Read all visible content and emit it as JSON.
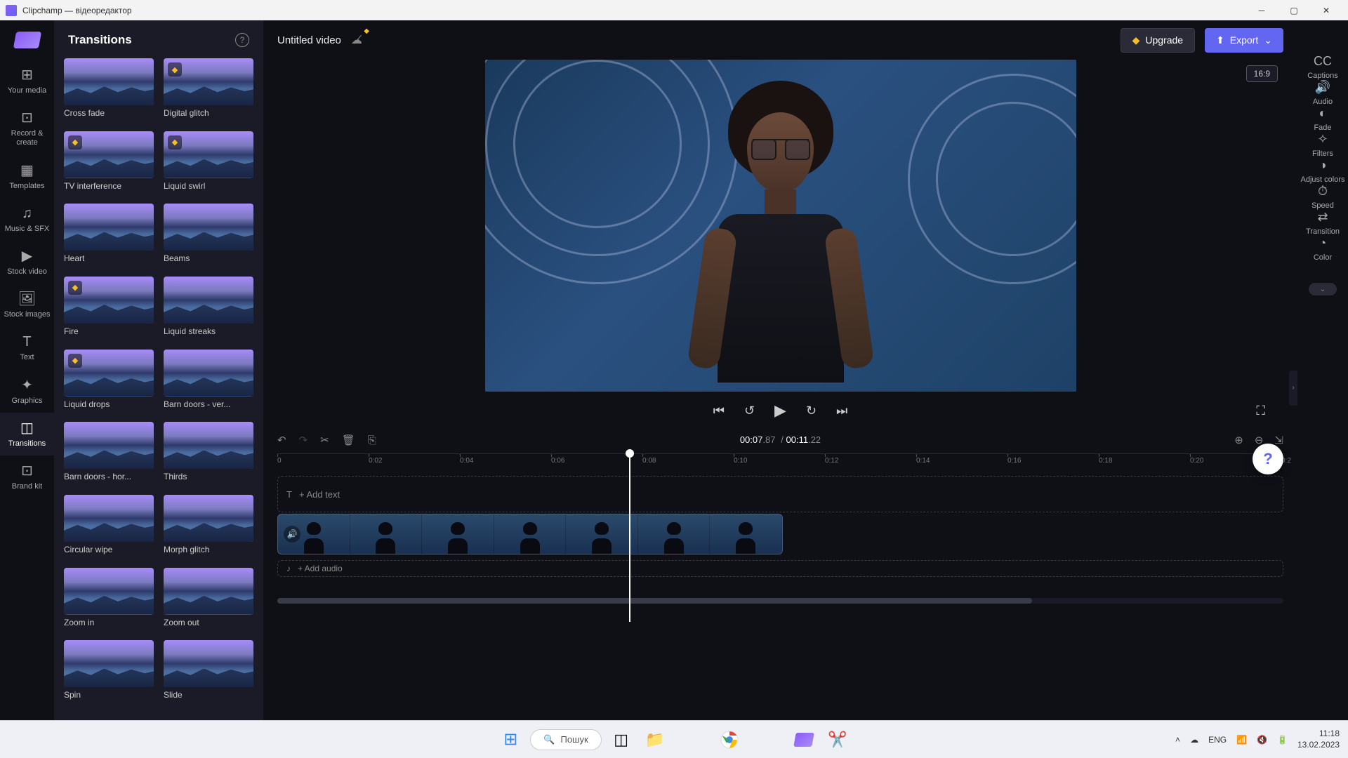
{
  "window": {
    "title": "Clipchamp — відеоредактор"
  },
  "leftnav": {
    "items": [
      {
        "label": "Your media",
        "icon": "⊞"
      },
      {
        "label": "Record & create",
        "icon": "⊡"
      },
      {
        "label": "Templates",
        "icon": "▦"
      },
      {
        "label": "Music & SFX",
        "icon": "♫"
      },
      {
        "label": "Stock video",
        "icon": "▶"
      },
      {
        "label": "Stock images",
        "icon": "🖼"
      },
      {
        "label": "Text",
        "icon": "T"
      },
      {
        "label": "Graphics",
        "icon": "✦"
      },
      {
        "label": "Transitions",
        "icon": "◫",
        "active": true
      },
      {
        "label": "Brand kit",
        "icon": "⊡"
      }
    ]
  },
  "panel": {
    "title": "Transitions",
    "items": [
      {
        "label": "Cross fade",
        "premium": false
      },
      {
        "label": "Digital glitch",
        "premium": true
      },
      {
        "label": "TV interference",
        "premium": true
      },
      {
        "label": "Liquid swirl",
        "premium": true
      },
      {
        "label": "Heart",
        "premium": false
      },
      {
        "label": "Beams",
        "premium": false
      },
      {
        "label": "Fire",
        "premium": true
      },
      {
        "label": "Liquid streaks",
        "premium": false
      },
      {
        "label": "Liquid drops",
        "premium": true
      },
      {
        "label": "Barn doors - ver...",
        "premium": false
      },
      {
        "label": "Barn doors - hor...",
        "premium": false
      },
      {
        "label": "Thirds",
        "premium": false
      },
      {
        "label": "Circular wipe",
        "premium": false
      },
      {
        "label": "Morph glitch",
        "premium": false
      },
      {
        "label": "Zoom in",
        "premium": false
      },
      {
        "label": "Zoom out",
        "premium": false
      },
      {
        "label": "Spin",
        "premium": false
      },
      {
        "label": "Slide",
        "premium": false
      }
    ]
  },
  "topbar": {
    "project": "Untitled video",
    "upgrade": "Upgrade",
    "export": "Export",
    "aspect": "16:9"
  },
  "rightbar": {
    "items": [
      {
        "label": "Captions",
        "icon": "CC"
      },
      {
        "label": "Audio",
        "icon": "🔊"
      },
      {
        "label": "Fade",
        "icon": "◐"
      },
      {
        "label": "Filters",
        "icon": "✧"
      },
      {
        "label": "Adjust colors",
        "icon": "◑"
      },
      {
        "label": "Speed",
        "icon": "⏱"
      },
      {
        "label": "Transition",
        "icon": "⇄"
      },
      {
        "label": "Color",
        "icon": "◔"
      }
    ]
  },
  "timeline": {
    "current": "00:07",
    "current_ms": ".87",
    "total": "00:11",
    "total_ms": ".22",
    "ticks": [
      "0",
      "0:02",
      "0:04",
      "0:06",
      "0:08",
      "0:10",
      "0:12",
      "0:14",
      "0:16",
      "0:18",
      "0:20",
      "0:2"
    ],
    "add_text": "+ Add text",
    "add_audio": "+ Add audio"
  },
  "taskbar": {
    "search": "Пошук",
    "lang": "ENG",
    "time": "11:18",
    "date": "13.02.2023"
  }
}
